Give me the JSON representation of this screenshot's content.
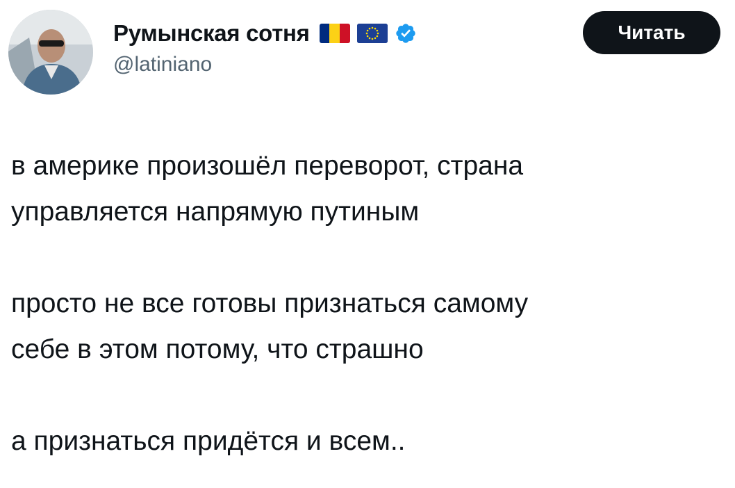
{
  "author": {
    "display_name": "Румынская сотня",
    "handle": "@latiniano",
    "verified": true,
    "flags": [
      "romania-flag-icon",
      "eu-flag-icon"
    ]
  },
  "follow_button": {
    "label": "Читать"
  },
  "tweet": {
    "paragraphs": [
      {
        "lines": [
          "в америке произошёл переворот, страна",
          "управляется напрямую путиным"
        ]
      },
      {
        "lines": [
          "просто не все готовы признаться самому",
          "себе в этом потому, что страшно"
        ]
      },
      {
        "lines": [
          "а признаться придётся и всем.."
        ]
      }
    ]
  },
  "colors": {
    "text": "#0f1419",
    "secondary_text": "#536471",
    "verified_blue": "#1d9bf0",
    "button_bg": "#0f1419",
    "romania_blue": "#002b7f",
    "romania_yellow": "#fcd116",
    "romania_red": "#ce1126",
    "eu_blue": "#1c3f94",
    "eu_star": "#ffdd00"
  }
}
